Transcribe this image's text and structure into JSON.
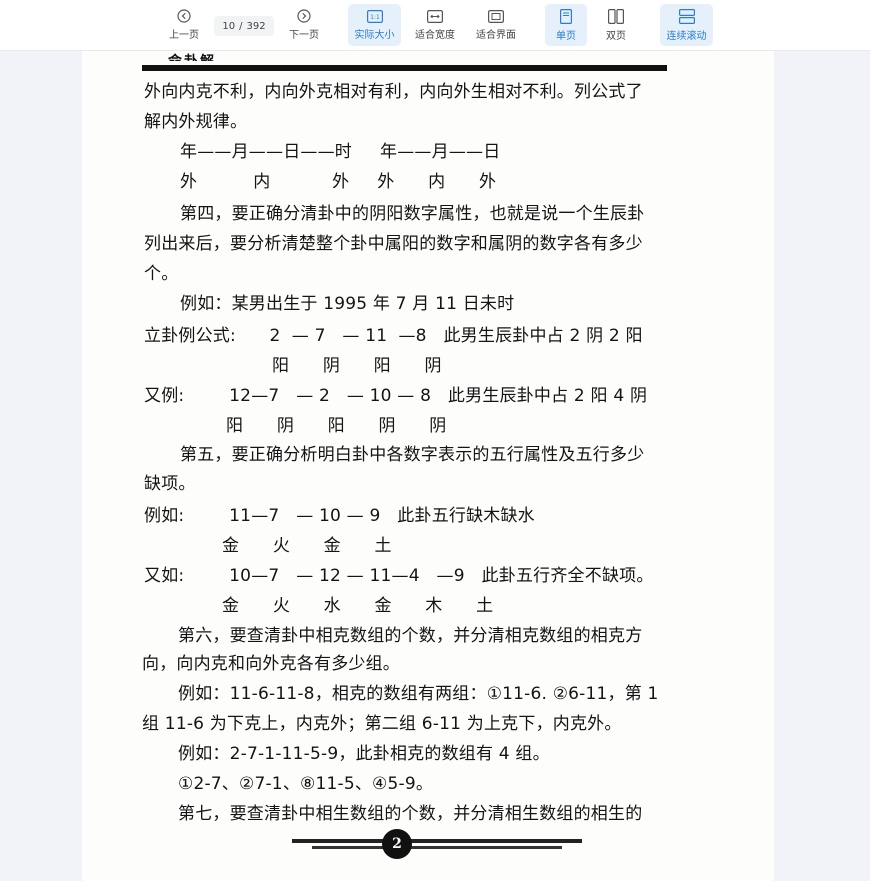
{
  "toolbar": {
    "prev_label": "上一页",
    "next_label": "下一页",
    "current_page": "10",
    "page_sep": "/",
    "total_pages": "392",
    "actual_size_label": "实际大小",
    "actual_size_icon_text": "1:1",
    "fit_width_label": "适合宽度",
    "fit_screen_label": "适合界面",
    "single_page_label": "单页",
    "double_page_label": "双页",
    "continuous_label": "连续滚动"
  },
  "page": {
    "header_text": "命卦解",
    "page_number": "2",
    "lines": [
      "外向内克不利，内向外克相对有利，内向外生相对不利。列公式了",
      "解内外规律。",
      "年——月——日——时     年——月——日",
      "外          内           外     外      内      外",
      "第四，要正确分清卦中的阴阳数字属性，也就是说一个生辰卦",
      "列出来后，要分析清楚整个卦中属阳的数字和属阴的数字各有多少",
      "个。",
      "例如：某男出生于 1995 年 7 月 11 日未时",
      "立卦例公式:      2  — 7   — 11  —8   此男生辰卦中占 2 阴 2 阳",
      "阳      阴      阳      阴",
      "又例:        12—7   — 2   — 10 — 8   此男生辰卦中占 2 阳 4 阴",
      "阳      阴      阳      阴      阴",
      "第五，要正确分析明白卦中各数字表示的五行属性及五行多少",
      "缺项。",
      "例如:        11—7   — 10 — 9   此卦五行缺木缺水",
      "金      火      金      土",
      "又如:        10—7   — 12 — 11—4   —9   此卦五行齐全不缺项。",
      "金      火      水      金      木      土",
      "第六，要查清卦中相克数组的个数，并分清相克数组的相克方",
      "向，向内克和向外克各有多少组。",
      "例如：11-6-11-8，相克的数组有两组：①11-6. ②6-11，第 1",
      "组 11-6 为下克上，内克外；第二组 6-11 为上克下，内克外。",
      "例如：2-7-1-11-5-9，此卦相克的数组有 4 组。",
      "①2-7、②7-1、⑧11-5、④5-9。",
      "第七，要查清卦中相生数组的个数，并分清相生数组的相生的"
    ]
  }
}
